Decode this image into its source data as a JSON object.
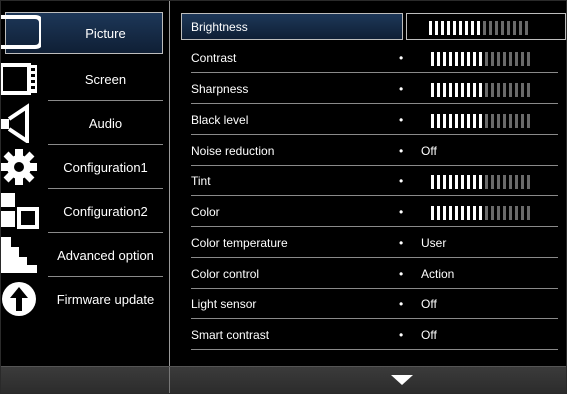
{
  "left_menu": {
    "items": [
      {
        "label": "Picture",
        "icon": "picture-icon",
        "selected": true
      },
      {
        "label": "Screen",
        "icon": "screen-icon",
        "selected": false
      },
      {
        "label": "Audio",
        "icon": "audio-icon",
        "selected": false
      },
      {
        "label": "Configuration1",
        "icon": "configuration-gear-icon",
        "selected": false
      },
      {
        "label": "Configuration2",
        "icon": "configuration-blocks-icon",
        "selected": false
      },
      {
        "label": "Advanced option",
        "icon": "advanced-option-icon",
        "selected": false
      },
      {
        "label": "Firmware update",
        "icon": "firmware-update-icon",
        "selected": false
      }
    ]
  },
  "settings": {
    "rows": [
      {
        "label": "Brightness",
        "type": "bar",
        "level": 0.53,
        "selected": true
      },
      {
        "label": "Contrast",
        "type": "bar",
        "level": 0.53
      },
      {
        "label": "Sharpness",
        "type": "bar",
        "level": 0.53
      },
      {
        "label": "Black level",
        "type": "bar",
        "level": 0.53
      },
      {
        "label": "Noise reduction",
        "type": "text",
        "value": "Off"
      },
      {
        "label": "Tint",
        "type": "bar",
        "level": 0.53
      },
      {
        "label": "Color",
        "type": "bar",
        "level": 0.53
      },
      {
        "label": "Color temperature",
        "type": "text",
        "value": "User"
      },
      {
        "label": "Color control",
        "type": "text",
        "value": "Action"
      },
      {
        "label": "Light sensor",
        "type": "text",
        "value": "Off"
      },
      {
        "label": "Smart contrast",
        "type": "text",
        "value": "Off"
      }
    ]
  },
  "footer": {
    "scroll_icon": "triangle-down-icon"
  },
  "colors": {
    "highlight": "#1d3758",
    "bar_on": "#ffffff",
    "bar_off": "#6a6a6a",
    "separator": "#8a8a8a"
  }
}
